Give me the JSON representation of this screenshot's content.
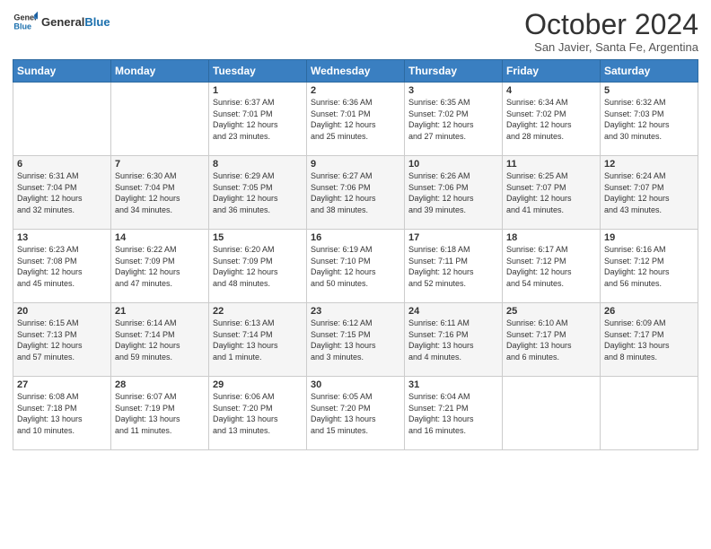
{
  "header": {
    "logo_line1": "General",
    "logo_line2": "Blue",
    "month_title": "October 2024",
    "subtitle": "San Javier, Santa Fe, Argentina"
  },
  "weekdays": [
    "Sunday",
    "Monday",
    "Tuesday",
    "Wednesday",
    "Thursday",
    "Friday",
    "Saturday"
  ],
  "weeks": [
    [
      {
        "day": "",
        "info": ""
      },
      {
        "day": "",
        "info": ""
      },
      {
        "day": "1",
        "info": "Sunrise: 6:37 AM\nSunset: 7:01 PM\nDaylight: 12 hours\nand 23 minutes."
      },
      {
        "day": "2",
        "info": "Sunrise: 6:36 AM\nSunset: 7:01 PM\nDaylight: 12 hours\nand 25 minutes."
      },
      {
        "day": "3",
        "info": "Sunrise: 6:35 AM\nSunset: 7:02 PM\nDaylight: 12 hours\nand 27 minutes."
      },
      {
        "day": "4",
        "info": "Sunrise: 6:34 AM\nSunset: 7:02 PM\nDaylight: 12 hours\nand 28 minutes."
      },
      {
        "day": "5",
        "info": "Sunrise: 6:32 AM\nSunset: 7:03 PM\nDaylight: 12 hours\nand 30 minutes."
      }
    ],
    [
      {
        "day": "6",
        "info": "Sunrise: 6:31 AM\nSunset: 7:04 PM\nDaylight: 12 hours\nand 32 minutes."
      },
      {
        "day": "7",
        "info": "Sunrise: 6:30 AM\nSunset: 7:04 PM\nDaylight: 12 hours\nand 34 minutes."
      },
      {
        "day": "8",
        "info": "Sunrise: 6:29 AM\nSunset: 7:05 PM\nDaylight: 12 hours\nand 36 minutes."
      },
      {
        "day": "9",
        "info": "Sunrise: 6:27 AM\nSunset: 7:06 PM\nDaylight: 12 hours\nand 38 minutes."
      },
      {
        "day": "10",
        "info": "Sunrise: 6:26 AM\nSunset: 7:06 PM\nDaylight: 12 hours\nand 39 minutes."
      },
      {
        "day": "11",
        "info": "Sunrise: 6:25 AM\nSunset: 7:07 PM\nDaylight: 12 hours\nand 41 minutes."
      },
      {
        "day": "12",
        "info": "Sunrise: 6:24 AM\nSunset: 7:07 PM\nDaylight: 12 hours\nand 43 minutes."
      }
    ],
    [
      {
        "day": "13",
        "info": "Sunrise: 6:23 AM\nSunset: 7:08 PM\nDaylight: 12 hours\nand 45 minutes."
      },
      {
        "day": "14",
        "info": "Sunrise: 6:22 AM\nSunset: 7:09 PM\nDaylight: 12 hours\nand 47 minutes."
      },
      {
        "day": "15",
        "info": "Sunrise: 6:20 AM\nSunset: 7:09 PM\nDaylight: 12 hours\nand 48 minutes."
      },
      {
        "day": "16",
        "info": "Sunrise: 6:19 AM\nSunset: 7:10 PM\nDaylight: 12 hours\nand 50 minutes."
      },
      {
        "day": "17",
        "info": "Sunrise: 6:18 AM\nSunset: 7:11 PM\nDaylight: 12 hours\nand 52 minutes."
      },
      {
        "day": "18",
        "info": "Sunrise: 6:17 AM\nSunset: 7:12 PM\nDaylight: 12 hours\nand 54 minutes."
      },
      {
        "day": "19",
        "info": "Sunrise: 6:16 AM\nSunset: 7:12 PM\nDaylight: 12 hours\nand 56 minutes."
      }
    ],
    [
      {
        "day": "20",
        "info": "Sunrise: 6:15 AM\nSunset: 7:13 PM\nDaylight: 12 hours\nand 57 minutes."
      },
      {
        "day": "21",
        "info": "Sunrise: 6:14 AM\nSunset: 7:14 PM\nDaylight: 12 hours\nand 59 minutes."
      },
      {
        "day": "22",
        "info": "Sunrise: 6:13 AM\nSunset: 7:14 PM\nDaylight: 13 hours\nand 1 minute."
      },
      {
        "day": "23",
        "info": "Sunrise: 6:12 AM\nSunset: 7:15 PM\nDaylight: 13 hours\nand 3 minutes."
      },
      {
        "day": "24",
        "info": "Sunrise: 6:11 AM\nSunset: 7:16 PM\nDaylight: 13 hours\nand 4 minutes."
      },
      {
        "day": "25",
        "info": "Sunrise: 6:10 AM\nSunset: 7:17 PM\nDaylight: 13 hours\nand 6 minutes."
      },
      {
        "day": "26",
        "info": "Sunrise: 6:09 AM\nSunset: 7:17 PM\nDaylight: 13 hours\nand 8 minutes."
      }
    ],
    [
      {
        "day": "27",
        "info": "Sunrise: 6:08 AM\nSunset: 7:18 PM\nDaylight: 13 hours\nand 10 minutes."
      },
      {
        "day": "28",
        "info": "Sunrise: 6:07 AM\nSunset: 7:19 PM\nDaylight: 13 hours\nand 11 minutes."
      },
      {
        "day": "29",
        "info": "Sunrise: 6:06 AM\nSunset: 7:20 PM\nDaylight: 13 hours\nand 13 minutes."
      },
      {
        "day": "30",
        "info": "Sunrise: 6:05 AM\nSunset: 7:20 PM\nDaylight: 13 hours\nand 15 minutes."
      },
      {
        "day": "31",
        "info": "Sunrise: 6:04 AM\nSunset: 7:21 PM\nDaylight: 13 hours\nand 16 minutes."
      },
      {
        "day": "",
        "info": ""
      },
      {
        "day": "",
        "info": ""
      }
    ]
  ]
}
